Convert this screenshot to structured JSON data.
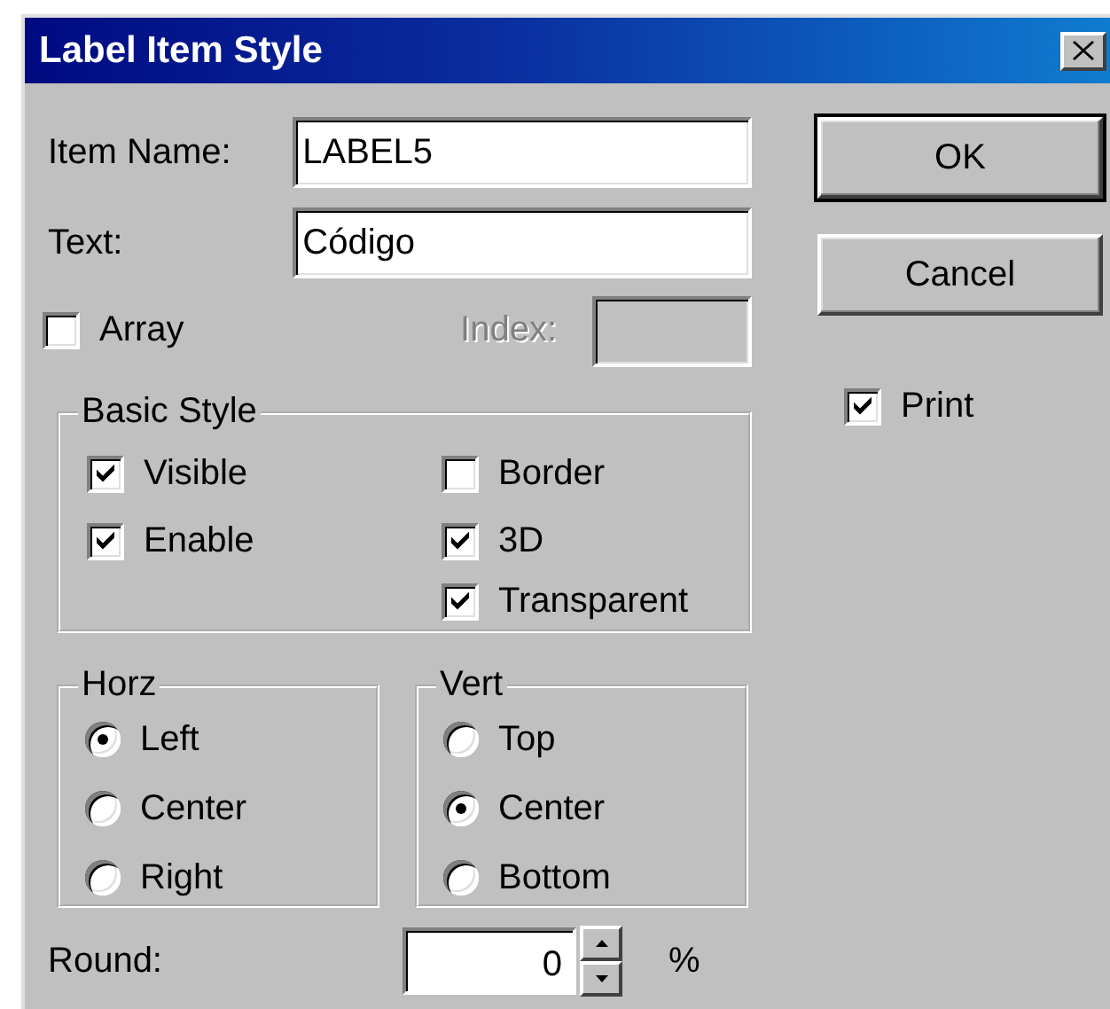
{
  "window": {
    "title": "Label Item Style"
  },
  "fields": [
    {
      "label": "Item Name:",
      "value": "LABEL5"
    },
    {
      "label": "Text:",
      "value": "Código"
    }
  ],
  "array": {
    "label": "Array",
    "checked": false
  },
  "index": {
    "label": "Index:",
    "disabled": true
  },
  "basic_style": {
    "title": "Basic Style",
    "options": [
      {
        "label": "Visible",
        "checked": true
      },
      {
        "label": "Enable",
        "checked": true
      },
      {
        "label": "Border",
        "checked": false
      },
      {
        "label": "3D",
        "checked": true
      },
      {
        "label": "Transparent",
        "checked": true
      }
    ]
  },
  "horz": {
    "title": "Horz",
    "options": [
      {
        "label": "Left",
        "selected": true
      },
      {
        "label": "Center",
        "selected": false
      },
      {
        "label": "Right",
        "selected": false
      }
    ]
  },
  "vert": {
    "title": "Vert",
    "options": [
      {
        "label": "Top",
        "selected": false
      },
      {
        "label": "Center",
        "selected": true
      },
      {
        "label": "Bottom",
        "selected": false
      }
    ]
  },
  "round": {
    "label": "Round:",
    "value": "0",
    "unit": "%"
  },
  "buttons": [
    {
      "label": "OK",
      "default": true
    },
    {
      "label": "Cancel",
      "default": false
    }
  ],
  "print": {
    "label": "Print",
    "checked": true
  }
}
